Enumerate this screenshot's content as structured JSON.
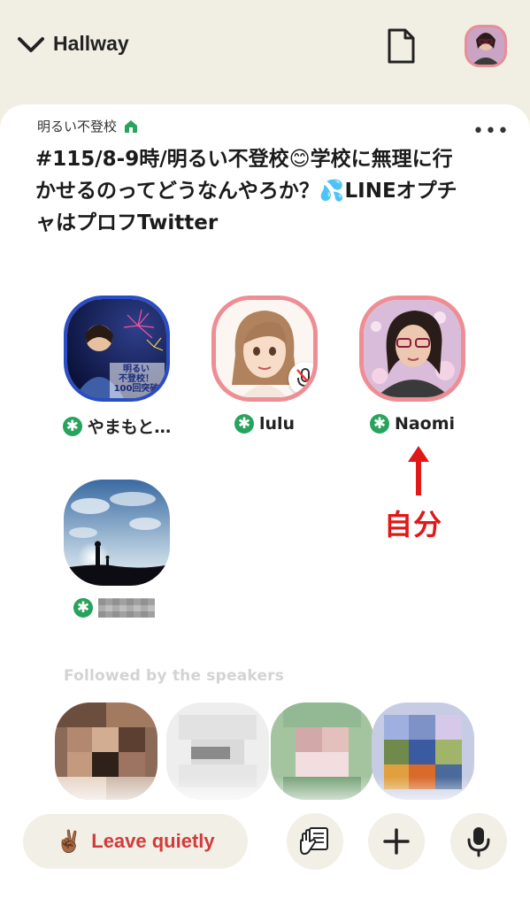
{
  "header": {
    "back_label": "Hallway",
    "icons": [
      "chevron-down-icon",
      "document-icon",
      "profile-avatar"
    ]
  },
  "room": {
    "club_name": "明るい不登校",
    "club_icon": "house-icon",
    "more_label": "•••",
    "title": "#115/8-9時/明るい不登校😊学校に無理に行かせるのってどうなんやろか？💦LINEオプチャはプロフTwitter"
  },
  "speakers": [
    {
      "name": "やまもと…",
      "moderator": true,
      "avatar_text": "明るい\n不登校！\n100回突破"
    },
    {
      "name": "lulu",
      "moderator": true,
      "muted": true
    },
    {
      "name": "Naomi",
      "moderator": true
    },
    {
      "name": "",
      "moderator": true,
      "name_obscured": true
    }
  ],
  "annotation": {
    "label": "自分",
    "color": "#e11818"
  },
  "followed_section": {
    "label": "Followed by the speakers"
  },
  "footer": {
    "leave_emoji": "✌🏾",
    "leave_label": "Leave quietly",
    "buttons": [
      "raise-hand-icon",
      "plus-icon",
      "microphone-icon"
    ]
  },
  "colors": {
    "background": "#f1efe4",
    "accent_pink": "#ee8e94",
    "moderator_green": "#27a35c",
    "leave_red": "#d23b3b"
  }
}
